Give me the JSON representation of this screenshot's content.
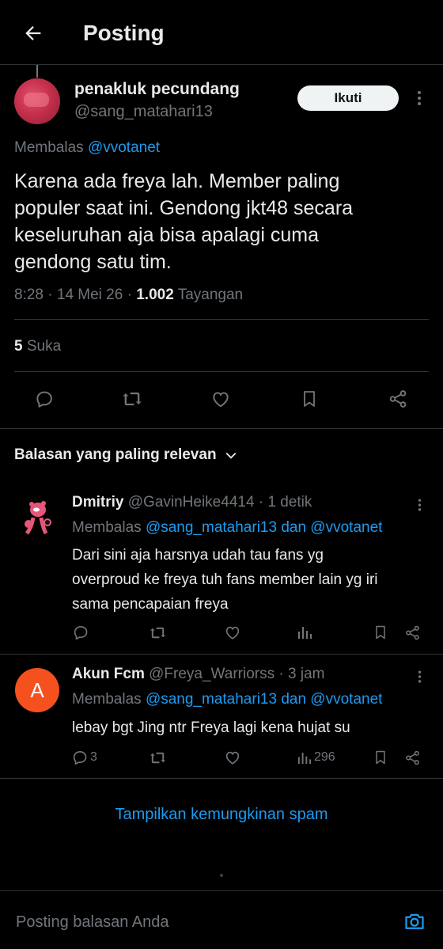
{
  "header": {
    "title": "Posting"
  },
  "post": {
    "display_name": "penakluk pecundang",
    "handle": "@sang_matahari13",
    "follow_label": "Ikuti",
    "replying_prefix": "Membalas",
    "replying_to": "@vvotanet",
    "text_lines": [
      "Karena ada freya lah. Member paling",
      "populer saat ini. Gendong jkt48 secara",
      "keseluruhan aja bisa apalagi cuma",
      "gendong satu tim."
    ],
    "time": "8:28",
    "date": "14 Mei 26",
    "views": "1.002",
    "views_label": "Tayangan",
    "likes_count": "5",
    "likes_label": "Suka"
  },
  "replies_header": {
    "label": "Balasan yang paling relevan"
  },
  "replies": [
    {
      "name": "Dmitriy",
      "handle": "@GavinHeike4414",
      "time": "1 detik",
      "replying_prefix": "Membalas",
      "replying_to": "@sang_matahari13 dan @vvotanet",
      "text_lines": [
        "Dari sini aja harsnya udah tau fans yg",
        "overproud ke freya tuh fans member lain yg iri",
        "sama pencapaian freya"
      ],
      "reply_count": "",
      "views": ""
    },
    {
      "name": "Akun Fcm",
      "handle": "@Freya_Warriorss",
      "time": "3 jam",
      "avatar_letter": "A",
      "replying_prefix": "Membalas",
      "replying_to": "@sang_matahari13 dan @vvotanet",
      "text_lines": [
        "lebay bgt Jing ntr Freya lagi kena hujat su"
      ],
      "reply_count": "3",
      "views": "296"
    }
  ],
  "show_spam": {
    "label": "Tampilkan kemungkinan spam"
  },
  "composer": {
    "placeholder": "Posting balasan Anda"
  },
  "colors": {
    "accent": "#1d9bf0",
    "avatar_orange": "#f4511e",
    "background": "#000000"
  },
  "icons": [
    "back-arrow-icon",
    "reply-icon",
    "retweet-icon",
    "like-icon",
    "bookmark-icon",
    "share-icon",
    "views-icon",
    "more-icon",
    "chevron-down-icon",
    "camera-icon"
  ]
}
